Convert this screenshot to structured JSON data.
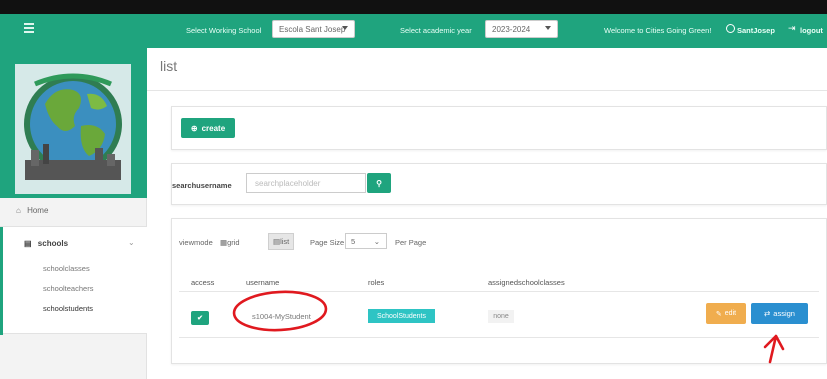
{
  "header": {
    "working_school_label": "Select Working School",
    "working_school_value": "Escola Sant Josep",
    "academic_year_label": "Select academic year",
    "academic_year_value": "2023-2024",
    "welcome_text": "Welcome to Cities Going Green!",
    "username": "SantJosep",
    "logout_label": "logout"
  },
  "sidebar": {
    "home_label": "Home",
    "schools_label": "schools",
    "sub_items": [
      "schoolclasses",
      "schoolteachers",
      "schoolstudents"
    ]
  },
  "page": {
    "title": "list"
  },
  "create_panel": {
    "create_label": "create"
  },
  "search_panel": {
    "label": "searchusername",
    "placeholder": "searchplaceholder"
  },
  "list_panel": {
    "viewmode_label": "viewmode",
    "grid_label": "grid",
    "list_label": "list",
    "page_size_label": "Page Size",
    "page_size_value": "5",
    "per_page_label": "Per Page",
    "columns": [
      "access",
      "username",
      "roles",
      "assignedschoolclasses"
    ],
    "rows": [
      {
        "username": "s1004-MyStudent",
        "role": "SchoolStudents",
        "assigned": "none",
        "edit_label": "edit",
        "assign_label": "assign"
      }
    ]
  },
  "colors": {
    "brand_green": "#1fa47e",
    "edit_orange": "#f0ad4e",
    "assign_blue": "#2a8fd0",
    "role_teal": "#2ec4c4",
    "annotation_red": "#e0191f"
  }
}
